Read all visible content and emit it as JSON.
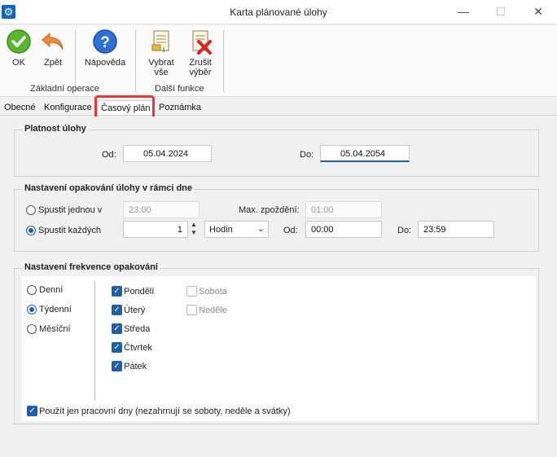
{
  "window": {
    "title": "Karta plánované úlohy",
    "app_icon": "gear-icon",
    "controls": {
      "minimize": "—",
      "maximize": "☐",
      "close": "✕"
    }
  },
  "ribbon": {
    "buttons": [
      {
        "label": "OK",
        "icon": "check-circle-icon"
      },
      {
        "label": "Zpět",
        "icon": "undo-arrow-icon"
      },
      {
        "label": "Nápověda",
        "icon": "help-icon"
      },
      {
        "label1": "Vybrat",
        "label2": "vše",
        "icon": "select-all-icon"
      },
      {
        "label1": "Zrušit",
        "label2": "výběr",
        "icon": "cancel-selection-icon"
      }
    ],
    "groups": [
      "Základní operace",
      "Další funkce"
    ]
  },
  "tabs": [
    "Obecné",
    "Konfigurace",
    "Časový plán",
    "Poznámka"
  ],
  "active_tab": "Časový plán",
  "validity": {
    "title": "Platnost úlohy",
    "from_label": "Od:",
    "from_value": "05.04.2024",
    "to_label": "Do:",
    "to_value": "05.04.2054"
  },
  "repeat": {
    "title": "Nastavení opakování úlohy v rámci dne",
    "once_label": "Spustit jednou v",
    "once_value": "23:00",
    "max_delay_label": "Max. zpoždění:",
    "max_delay_value": "01:00",
    "every_label": "Spustit každých",
    "every_value": "1",
    "unit_value": "Hodin",
    "from_label": "Od:",
    "from_value": "00:00",
    "to_label": "Do:",
    "to_value": "23:59",
    "selected": "every"
  },
  "frequency": {
    "title": "Nastavení frekvence opakování",
    "options": [
      "Denní",
      "Týdenní",
      "Měsíční"
    ],
    "selected": "Týdenní",
    "days": [
      {
        "label": "Pondělí",
        "checked": true
      },
      {
        "label": "Úterý",
        "checked": true
      },
      {
        "label": "Středa",
        "checked": true
      },
      {
        "label": "Čtvrtek",
        "checked": true
      },
      {
        "label": "Pátek",
        "checked": true
      },
      {
        "label": "Sobota",
        "checked": false
      },
      {
        "label": "Neděle",
        "checked": false
      }
    ],
    "workdays_label": "Použít jen pracovní dny (nezahrnují se soboty, neděle a svátky)",
    "workdays_checked": true
  },
  "colors": {
    "accent": "#1f5fa8",
    "highlight": "#e0393e"
  }
}
